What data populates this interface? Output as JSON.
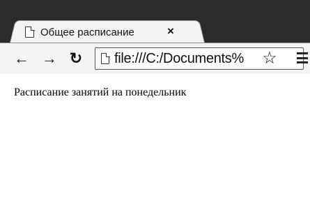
{
  "tab": {
    "title": "Общее расписание",
    "close_glyph": "×"
  },
  "toolbar": {
    "back_glyph": "←",
    "forward_glyph": "→",
    "reload_glyph": "↻",
    "url": "file:///C:/Documents%",
    "star_glyph": "☆"
  },
  "page": {
    "text": "Расписание занятий на понедельник"
  },
  "icons": {
    "tab_icon": "document-icon",
    "back": "back-arrow-icon",
    "forward": "forward-arrow-icon",
    "reload": "reload-icon",
    "star": "bookmark-star-icon",
    "menu": "menu-icon"
  }
}
